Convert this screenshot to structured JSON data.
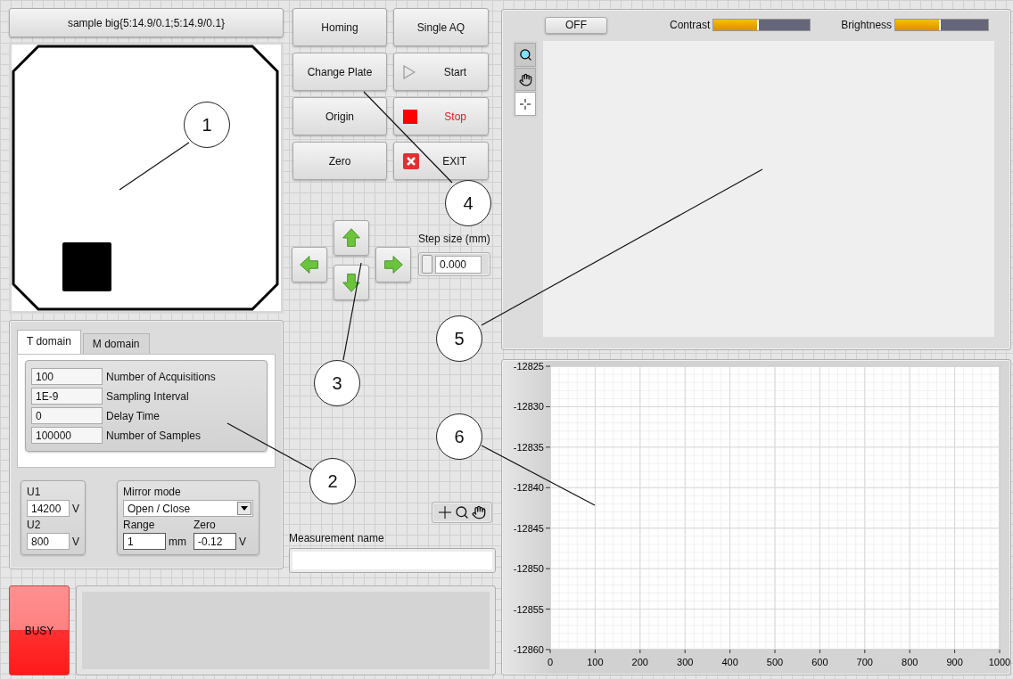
{
  "plate_selector": {
    "label": "sample big{5:14.9/0.1;5:14.9/0.1}"
  },
  "buttons": [
    {
      "label": "Homing",
      "kind": "plain"
    },
    {
      "label": "Single AQ",
      "kind": "plain"
    },
    {
      "label": "Change Plate",
      "kind": "plain"
    },
    {
      "label": "Start",
      "kind": "start"
    },
    {
      "label": "Origin",
      "kind": "plain"
    },
    {
      "label": "Stop",
      "kind": "stop"
    },
    {
      "label": "Zero",
      "kind": "plain"
    },
    {
      "label": "EXIT",
      "kind": "exit"
    }
  ],
  "step_size": {
    "label": "Step size (mm)",
    "value": "0.000"
  },
  "tabs": [
    {
      "label": "T domain",
      "selected": true
    },
    {
      "label": "M domain",
      "selected": false
    }
  ],
  "parameters": [
    {
      "value": "100",
      "label": "Number of Acquisitions"
    },
    {
      "value": "1E-9",
      "label": "Sampling Interval"
    },
    {
      "value": "0",
      "label": "Delay Time"
    },
    {
      "value": "100000",
      "label": "Number of Samples"
    }
  ],
  "voltages": [
    {
      "label": "U1",
      "value": "14200",
      "unit": "V"
    },
    {
      "label": "U2",
      "value": "800",
      "unit": "V"
    }
  ],
  "mirror": {
    "label": "Mirror mode",
    "value": "Open / Close",
    "range_label": "Range",
    "range_value": "1",
    "range_unit": "mm",
    "zero_label": "Zero",
    "zero_value": "-0.12",
    "zero_unit": "V"
  },
  "measurement_name": {
    "label": "Measurement name"
  },
  "busy": {
    "label": "BUSY",
    "on": true
  },
  "camera": {
    "toggle": "OFF",
    "contrast": {
      "label": "Contrast",
      "level": 0.47
    },
    "brightness": {
      "label": "Brightness",
      "level": 0.49
    }
  },
  "chart": {
    "chart_data": {
      "type": "line",
      "grid": true,
      "xlim": [
        0,
        1000
      ],
      "ylim": [
        -12860,
        -12825
      ],
      "xticks": [
        0,
        100,
        200,
        300,
        400,
        500,
        600,
        700,
        800,
        900,
        1000
      ],
      "yticks": [
        -12825,
        -12830,
        -12835,
        -12840,
        -12845,
        -12850,
        -12855,
        -12860
      ]
    }
  },
  "callouts": [
    "1",
    "2",
    "3",
    "4",
    "5",
    "6"
  ]
}
